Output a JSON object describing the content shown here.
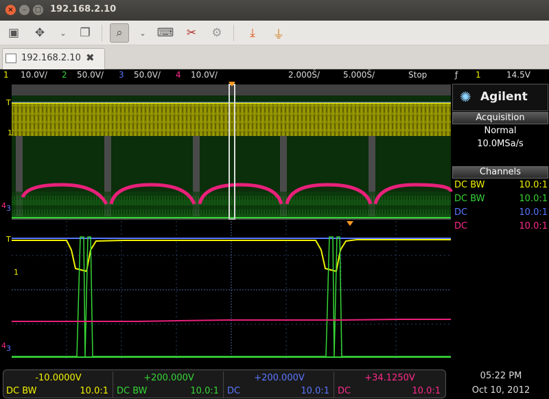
{
  "window": {
    "title": "192.168.2.10"
  },
  "tab": {
    "label": "192.168.2.10"
  },
  "toolbar": {
    "icons": [
      "screen-icon",
      "move-icon",
      "chevron-down-icon",
      "windows-icon",
      "zoom-icon",
      "chevron-down-icon",
      "keyboard-icon",
      "tools-icon",
      "gears-icon",
      "download-icon",
      "plug-icon"
    ]
  },
  "status_bar": {
    "ch1_num": "1",
    "ch1_scale": "10.0V/",
    "ch2_num": "2",
    "ch2_scale": "50.0V/",
    "ch3_num": "3",
    "ch3_scale": "50.0V/",
    "ch4_num": "4",
    "ch4_scale": "10.0V/",
    "timebase_1": "2.000Š/",
    "timebase_2": "5.000Š/",
    "run_state": "Stop",
    "trigger_symbol": "ƒ",
    "trigger_channel": "1",
    "trigger_level": "14.5V"
  },
  "panel": {
    "brand": "Agilent",
    "acquisition_title": "Acquisition",
    "acq_mode": "Normal",
    "acq_rate": "10.0MSa/s",
    "channels_title": "Channels",
    "channels": [
      {
        "coupling": "DC BW",
        "probe": "10.0:1",
        "color": "#f2f200"
      },
      {
        "coupling": "DC BW",
        "probe": "10.0:1",
        "color": "#37d637"
      },
      {
        "coupling": "DC",
        "probe": "10.0:1",
        "color": "#5a77ff"
      },
      {
        "coupling": "DC",
        "probe": "10.0:1",
        "color": "#ff2a8a"
      }
    ]
  },
  "markers": {
    "trigger": "T",
    "ch1": "1",
    "ch4": "4",
    "ch3": "3"
  },
  "bottom": {
    "offsets": [
      {
        "value": "-10.0000V",
        "coupling": "DC  BW",
        "probe": "10.0:1",
        "color": "#f2f200"
      },
      {
        "value": "+200.000V",
        "coupling": "DC  BW",
        "probe": "10.0:1",
        "color": "#37d637"
      },
      {
        "value": "+200.000V",
        "coupling": "DC",
        "probe": "10.0:1",
        "color": "#5a77ff"
      },
      {
        "value": "+34.1250V",
        "coupling": "DC",
        "probe": "10.0:1",
        "color": "#ff2a8a"
      }
    ],
    "time": "05:22 PM",
    "date": "Oct 10, 2012"
  }
}
